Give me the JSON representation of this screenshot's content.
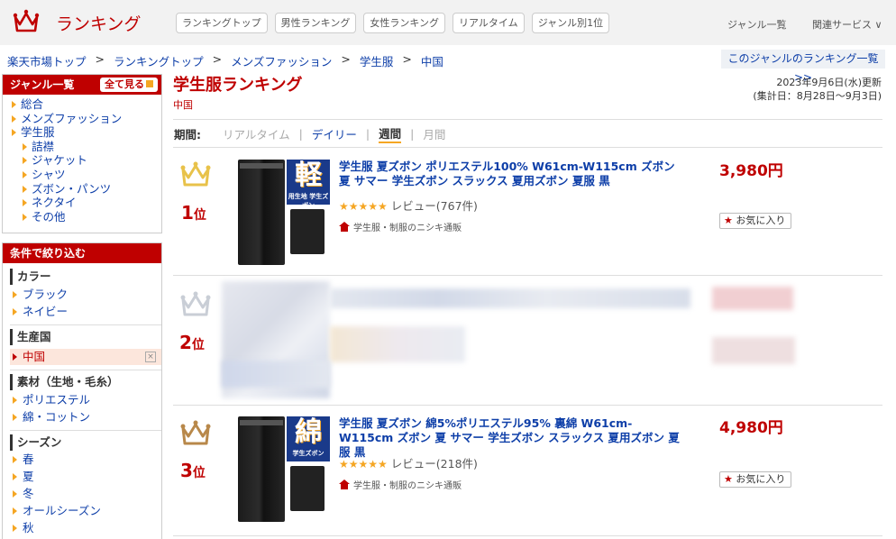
{
  "header": {
    "logo_text": "ランキング",
    "nav": [
      "ランキングトップ",
      "男性ランキング",
      "女性ランキング",
      "リアルタイム",
      "ジャンル別1位"
    ],
    "genre_list": "ジャンル一覧",
    "related": "関連サービス ∨"
  },
  "breadcrumb": [
    "楽天市場トップ",
    "ランキングトップ",
    "メンズファッション",
    "学生服",
    "中国"
  ],
  "breadcrumb_sep": ">",
  "genre_list_button": "このジャンルのランキング一覧 >>",
  "sidebar": {
    "genre_title": "ジャンル一覧",
    "all_button": "全て見る",
    "genres": [
      {
        "label": "総合",
        "sub": false
      },
      {
        "label": "メンズファッション",
        "sub": false
      },
      {
        "label": "学生服",
        "sub": false
      },
      {
        "label": "詰襟",
        "sub": true
      },
      {
        "label": "ジャケット",
        "sub": true
      },
      {
        "label": "シャツ",
        "sub": true
      },
      {
        "label": "ズボン・パンツ",
        "sub": true
      },
      {
        "label": "ネクタイ",
        "sub": true
      },
      {
        "label": "その他",
        "sub": true
      }
    ],
    "filter_title": "条件で絞り込む",
    "groups": [
      {
        "title": "カラー",
        "items": [
          "ブラック",
          "ネイビー"
        ]
      },
      {
        "title": "生産国",
        "items": [
          "中国"
        ]
      },
      {
        "title": "素材（生地・毛糸）",
        "items": [
          "ポリエステル",
          "綿・コットン"
        ]
      },
      {
        "title": "シーズン",
        "items": [
          "春",
          "夏",
          "冬",
          "オールシーズン",
          "秋"
        ]
      }
    ],
    "remove_icon": "×"
  },
  "main": {
    "title": "学生服ランキング",
    "subtitle": "中国",
    "updated": "2023年9月6日(水)更新",
    "period_range": "(集計日：8月28日〜9月3日)",
    "period_label": "期間:",
    "periods": [
      "リアルタイム",
      "デイリー",
      "週間",
      "月間"
    ],
    "rank_suffix": "位"
  },
  "products": [
    {
      "rank": "1",
      "tag_big": "軽",
      "tag_small": "用生地 学生ズボン",
      "name": "学生服 夏ズボン ポリエステル100% W61cm-W115cm ズボン 夏 サマー 学生ズボン スラックス 夏用ズボン 夏服 黒",
      "stars": "★★★★★",
      "review": "レビュー(767件)",
      "shop": "学生服・制服のニシキ通販",
      "price": "3,980円",
      "fav": "お気に入り"
    },
    {
      "rank": "2"
    },
    {
      "rank": "3",
      "tag_big": "綿",
      "tag_small": "学生ズボン",
      "name": "学生服 夏ズボン 綿5%ポリエステル95% 裏綿 W61cm-W115cm ズボン 夏 サマー 学生ズボン スラックス 夏用ズボン 夏服 黒",
      "stars": "★★★★★",
      "review": "レビュー(218件)",
      "shop": "学生服・制服のニシキ通販",
      "price": "4,980円",
      "fav": "お気に入り"
    }
  ],
  "colors": {
    "brand": "#bf0000",
    "link": "#0d3ea8",
    "accent": "#f5a623",
    "gold": "#e8c24a",
    "silver": "#c9ced6",
    "bronze": "#b8884a"
  }
}
